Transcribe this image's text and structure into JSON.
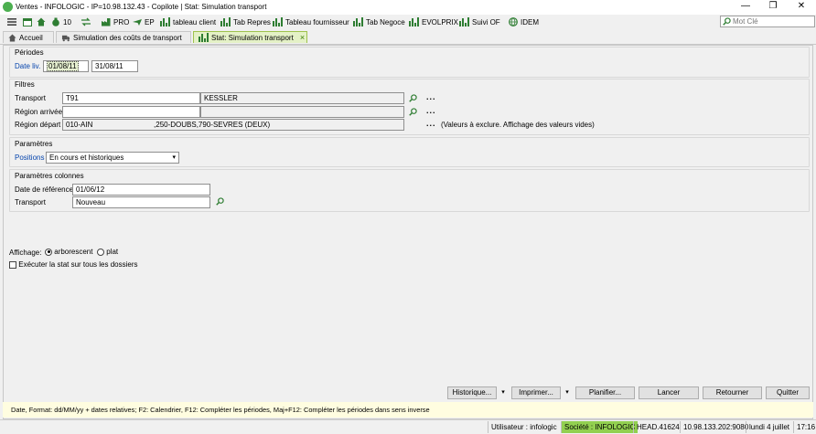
{
  "window": {
    "title": "Ventes - INFOLOGIC - IP=10.98.132.43 - Copilote | Stat: Simulation transport",
    "minimize": "—",
    "restore": "❐",
    "close": "✕"
  },
  "toolbar": {
    "count": "10",
    "items": [
      "PRO",
      "EP",
      "tableau client",
      "Tab Repres",
      "Tableau fournisseur",
      "Tab Negoce",
      "EVOLPRIX",
      "Suivi OF",
      "IDEM"
    ],
    "search_placeholder": "Mot Clé"
  },
  "tabs": [
    {
      "label": "Accueil"
    },
    {
      "label": "Simulation des coûts de transport"
    },
    {
      "label": "Stat: Simulation transport",
      "close": "×"
    }
  ],
  "periodes": {
    "title": "Périodes",
    "date_label": "Date liv.",
    "date_from": "01/08/11",
    "date_to": "31/08/11"
  },
  "filtres": {
    "title": "Filtres",
    "transport_label": "Transport",
    "transport_code": "T91",
    "transport_name": "KESSLER",
    "region_arrivee_label": "Région arrivée",
    "region_depart_label": "Région départ",
    "region_depart_value": "010-AIN                              ,250-DOUBS,790-SEVRES (DEUX)",
    "more": "...",
    "exclude_note": "(Valeurs à exclure. Affichage des valeurs vides)"
  },
  "parametres": {
    "title": "Paramètres",
    "positions_label": "Positions",
    "positions_value": "En cours et historiques"
  },
  "parametres_colonnes": {
    "title": "Paramètres colonnes",
    "date_ref_label": "Date de référence",
    "date_ref_value": "01/06/12",
    "transport_label": "Transport",
    "transport_value": "Nouveau"
  },
  "affichage": {
    "label": "Affichage:",
    "option1": "arborescent",
    "option2": "plat",
    "selected": "arborescent"
  },
  "executer_label": "Exécuter la stat sur tous les dossiers",
  "buttons": {
    "historique": "Historique...",
    "imprimer": "Imprimer...",
    "planifier": "Planifier...",
    "lancer": "Lancer",
    "retourner": "Retourner",
    "quitter": "Quitter",
    "dropdown": "▾"
  },
  "hint": "Date, Format: dd/MM/yy + dates relatives; F2: Calendrier, F12: Compléter les périodes, Maj+F12: Compléter les périodes dans sens inverse",
  "status": {
    "user": "Utilisateur : infologic",
    "societe": "Société : INFOLOGIC",
    "head": "HEAD.41624",
    "server": "10.98.133.202:9080",
    "date": "lundi 4 juillet",
    "time": "17:16"
  },
  "colors": {
    "accent_green": "#92d050",
    "tab_active": "#e4f1c6",
    "link_blue": "#0645ad",
    "hint_bg": "#fffde0"
  }
}
